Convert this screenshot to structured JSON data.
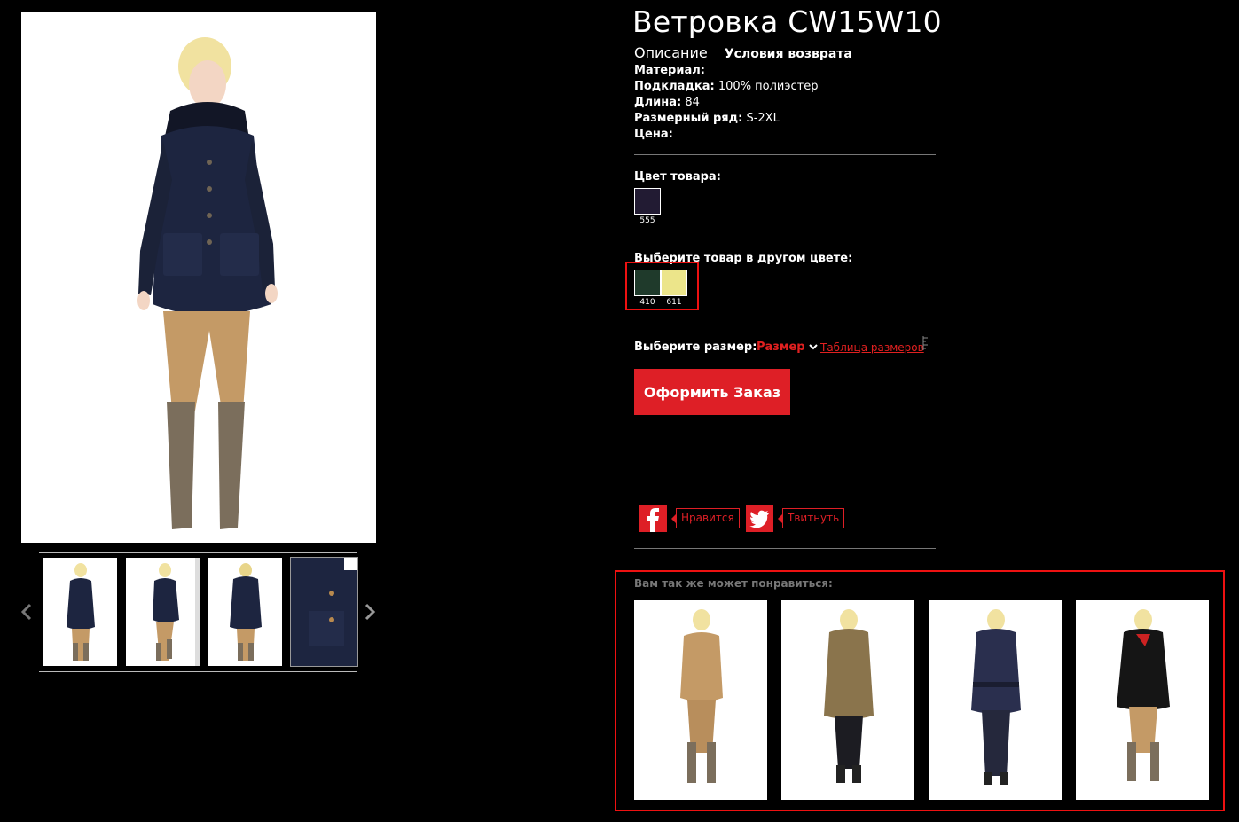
{
  "product": {
    "title": "Ветровка CW15W10",
    "tabs": {
      "description": "Описание",
      "returns": "Условия возврата"
    },
    "specs": [
      {
        "key": "Материал:",
        "value": ""
      },
      {
        "key": "Подкладка:",
        "value": "100% полиэстер"
      },
      {
        "key": "Длина:",
        "value": "84"
      },
      {
        "key": "Размерный ряд:",
        "value": "S-2XL"
      },
      {
        "key": "Цена:",
        "value": ""
      }
    ]
  },
  "color": {
    "label": "Цвет товара:",
    "current": {
      "code": "555",
      "hex": "#221b33"
    }
  },
  "other_colors": {
    "label": "Выберите товар в другом цвете:",
    "items": [
      {
        "code": "410",
        "hex": "#1f3a2b"
      },
      {
        "code": "611",
        "hex": "#ece58a"
      }
    ]
  },
  "size": {
    "label": "Выберите размер:",
    "select_value": "Размер",
    "chart_link": "Таблица размеров"
  },
  "order_button": "Оформить Заказ",
  "social": {
    "facebook_label": "Нравится",
    "twitter_label": "Твитнуть"
  },
  "recommendations": {
    "title": "Вам так же может понравиться:"
  },
  "colors": {
    "accent": "#de1f26",
    "background": "#000000",
    "coat_navy": "#1d2540",
    "pants_camel": "#c49a66",
    "boots": "#7b6e5c"
  }
}
